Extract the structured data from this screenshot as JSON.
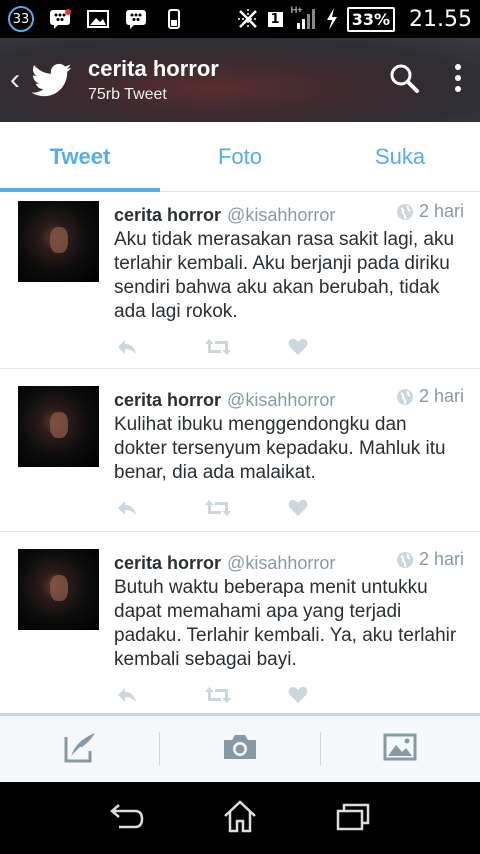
{
  "status_bar": {
    "notification_count": "33",
    "battery": "33%",
    "time": "21.55",
    "sim": "1",
    "network": "H+",
    "icons": [
      "bbm-icon",
      "image-icon",
      "bbm-icon",
      "phone-vibrate-icon",
      "mute-icon",
      "signal-icon",
      "charging-icon"
    ]
  },
  "header": {
    "title": "cerita horror",
    "subtitle": "75rb Tweet",
    "icons": [
      "back-icon",
      "twitter-bird-icon",
      "search-icon",
      "overflow-menu-icon"
    ]
  },
  "tabs": [
    {
      "label": "Tweet",
      "active": true
    },
    {
      "label": "Foto",
      "active": false
    },
    {
      "label": "Suka",
      "active": false
    }
  ],
  "tweets": [
    {
      "name": "cerita horror",
      "handle": "@kisahhorror",
      "time": "2 hari",
      "text": "Aku tidak merasakan rasa sakit lagi, aku terlahir kembali. Aku berjanji pada diriku sendiri bahwa aku akan berubah, tidak ada lagi rokok."
    },
    {
      "name": "cerita horror",
      "handle": "@kisahhorror",
      "time": "2 hari",
      "text": "Kulihat ibuku menggendongku dan dokter tersenyum kepadaku. Mahluk itu benar, dia ada malaikat."
    },
    {
      "name": "cerita horror",
      "handle": "@kisahhorror",
      "time": "2 hari",
      "text": "Butuh waktu beberapa menit untukku dapat memahami apa yang terjadi padaku. Terlahir kembali. Ya, aku terlahir kembali sebagai bayi."
    }
  ],
  "toolbar": {
    "icons": [
      "compose-tweet-icon",
      "camera-icon",
      "gallery-icon"
    ]
  },
  "navbar": {
    "icons": [
      "back-nav-icon",
      "home-nav-icon",
      "recent-apps-icon"
    ]
  },
  "colors": {
    "accent": "#55acee",
    "muted": "#8899a6",
    "text": "#292f33"
  }
}
